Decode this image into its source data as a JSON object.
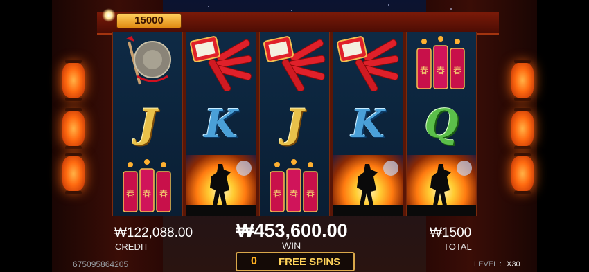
{
  "jackpot": {
    "value": "15000"
  },
  "reels": [
    [
      "gong",
      "J",
      "firecrackers"
    ],
    [
      "firecracker-bundle",
      "K",
      "fire-dancer"
    ],
    [
      "firecracker-bundle",
      "J",
      "firecrackers"
    ],
    [
      "firecracker-bundle",
      "K",
      "fire-dancer"
    ],
    [
      "firecrackers",
      "Q",
      "fire-dancer"
    ]
  ],
  "reel_letters": {
    "r0": "J",
    "r1": "K",
    "r2": "J",
    "r3": "K",
    "r4": "Q"
  },
  "stick_char": "春",
  "credit": {
    "value": "₩122,088.00",
    "label": "CREDIT"
  },
  "win": {
    "value": "₩453,600.00",
    "label": "WIN"
  },
  "total": {
    "value": "₩1500",
    "label": "TOTAL"
  },
  "free_spins": {
    "count": "0",
    "label": "FREE SPINS"
  },
  "session_id": "675095864205",
  "level": {
    "label": "LEVEL :",
    "value": "X30"
  },
  "colors": {
    "accent_gold": "#ffd35a",
    "reel_bg": "#0e2a45",
    "frame_red": "#7a1a08"
  }
}
